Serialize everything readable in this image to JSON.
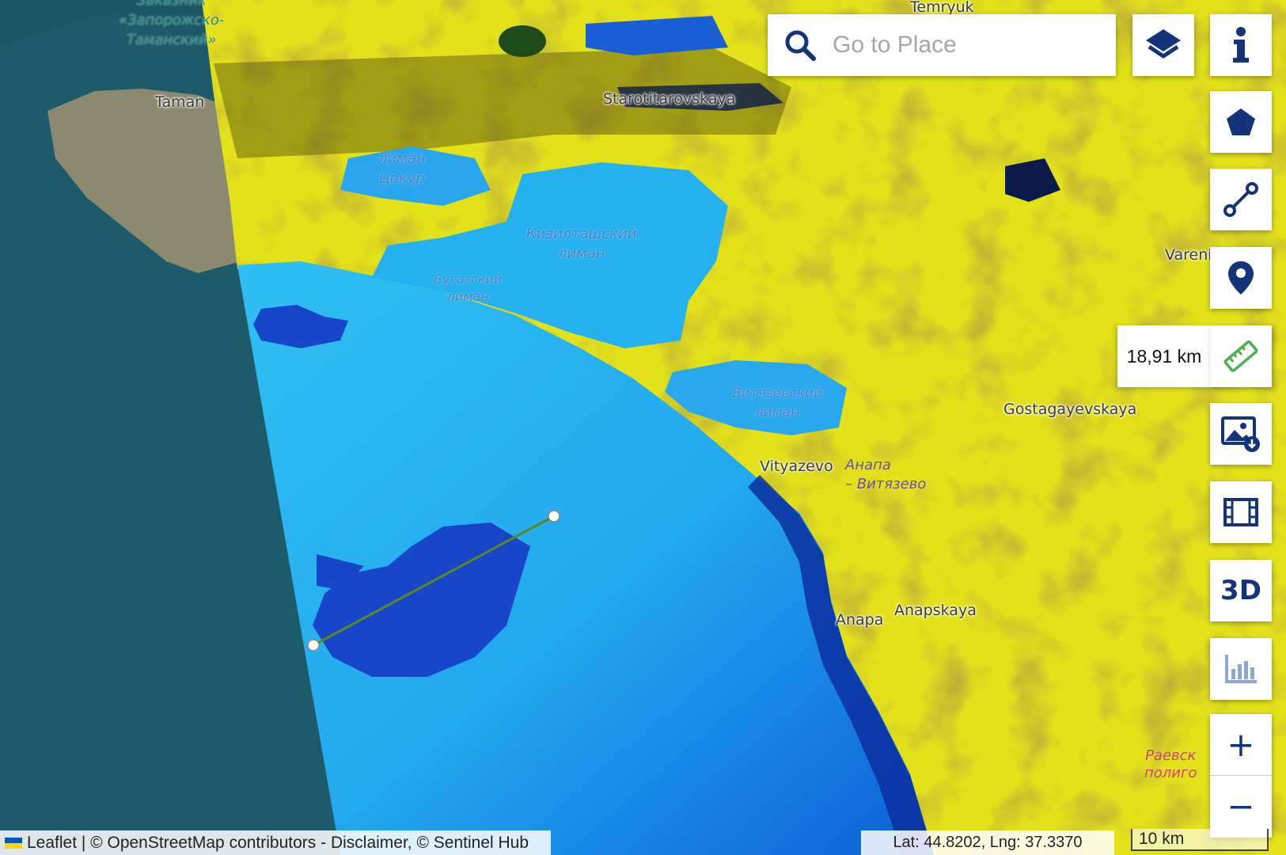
{
  "map": {
    "labels": {
      "reserve_line1": "Заказник",
      "reserve_line2": "«Запорожско-",
      "reserve_line3": "Таманский»",
      "temryuk": "Temryuk",
      "taman": "Taman",
      "starotitarovskaya": "Starotitarovskaya",
      "akhtanizovsky_line1": "лиман",
      "akhtanizovsky_line2": "Цокур",
      "kiziltash_line1": "Кизилташский",
      "kiziltash_line2": "лиман",
      "bugaz_line1": "Бугазский",
      "bugaz_line2": "лиман",
      "vityazevsky_line1": "Витязевский",
      "vityazevsky_line2": "лиман",
      "vareni": "Vareni",
      "gostagayevskaya": "Gostagayevskaya",
      "vityazevo": "Vityazevo",
      "anapa_vityazevo_line1": "Анапа",
      "anapa_vityazevo_line2": "– Витязево",
      "anapa": "Anapa",
      "anapskaya": "Anapskaya",
      "raevsky_line1": "Раевск",
      "raevsky_line2": "полиго"
    }
  },
  "search": {
    "placeholder": "Go to Place"
  },
  "toolbar": {
    "layers_icon": "layers-icon",
    "info_icon": "info-icon",
    "polygon_icon": "pentagon-icon",
    "line_icon": "line-icon",
    "marker_icon": "map-pin-icon",
    "measure_icon": "ruler-icon",
    "measure_value": "18,91 km",
    "image_download_icon": "image-download-icon",
    "timelapse_icon": "film-icon",
    "three_d_label": "3D",
    "chart_icon": "bar-chart-icon",
    "zoom_in_label": "+",
    "zoom_out_label": "−"
  },
  "footer": {
    "attribution": "Leaflet | © OpenStreetMap contributors - Disclaimer, © Sentinel Hub",
    "coordinates": "Lat: 44.8202, Lng: 37.3370",
    "scale": "10 km"
  },
  "colors": {
    "control_icon": "#13347a",
    "measure_icon": "#4caf50",
    "measure_line": "#5a8a1f",
    "land_false_color": "#e3e21a",
    "water_false_color": "#23b2f0"
  }
}
